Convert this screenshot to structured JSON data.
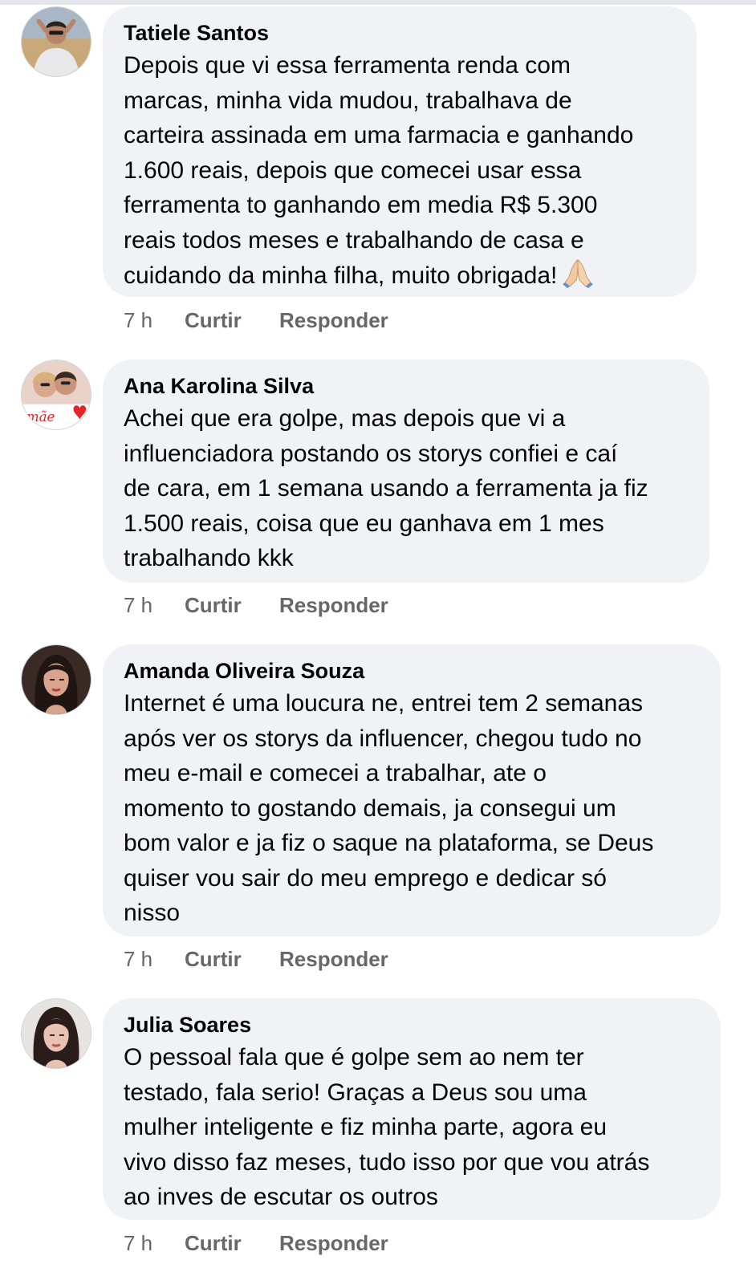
{
  "comments": [
    {
      "author": "Tatiele Santos",
      "text": "Depois que vi essa ferramenta renda com\nmarcas, minha vida mudou, trabalhava de\ncarteira assinada em uma farmacia e ganhando\n1.600 reais, depois que comecei usar essa\nferramenta to ganhando em media R$ 5.300\nreais todos meses e trabalhando de casa e\ncuidando da minha filha, muito obrigada!",
      "emoji": "folded-hands",
      "time": "7 h",
      "like_label": "Curtir",
      "reply_label": "Responder"
    },
    {
      "author": "Ana Karolina Silva",
      "avatar_text": "mãe",
      "text": "Achei que era golpe, mas depois que vi a\ninfluenciadora postando os storys confiei e caí\nde cara, em 1 semana usando a ferramenta ja fiz\n1.500 reais, coisa que eu ganhava em 1 mes\ntrabalhando kkk",
      "time": "7 h",
      "like_label": "Curtir",
      "reply_label": "Responder"
    },
    {
      "author": "Amanda Oliveira Souza",
      "text": "Internet é uma loucura ne, entrei tem 2 semanas\napós ver os storys da influencer, chegou tudo no\nmeu e-mail e comecei a trabalhar, ate o\nmomento to gostando demais, ja consegui um\nbom valor e ja fiz o saque na plataforma, se Deus\nquiser vou sair do meu emprego e dedicar só\nnisso",
      "time": "7 h",
      "like_label": "Curtir",
      "reply_label": "Responder"
    },
    {
      "author": "Julia Soares",
      "text": "O pessoal fala que é golpe sem ao nem ter\ntestado, fala serio! Graças a Deus sou uma\nmulher inteligente e fiz minha parte, agora eu\nvivo disso faz meses, tudo isso por que vou atrás\nao inves de escutar os outros",
      "time": "7 h",
      "like_label": "Curtir",
      "reply_label": "Responder"
    }
  ],
  "colors": {
    "bubble_bg": "#f0f2f5",
    "meta_text": "#65676b",
    "primary_text": "#050505"
  }
}
